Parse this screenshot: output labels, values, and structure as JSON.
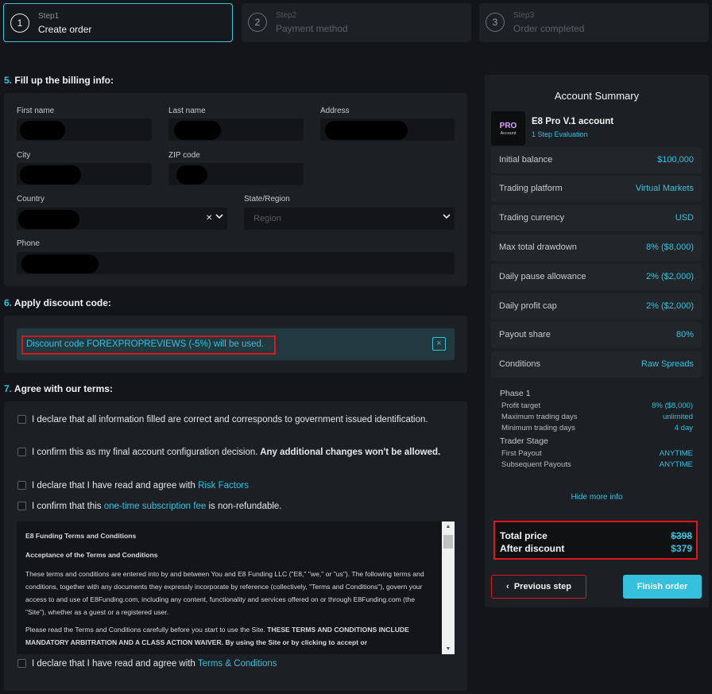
{
  "steps": [
    {
      "num": "1",
      "small": "Step1",
      "label": "Create order"
    },
    {
      "num": "2",
      "small": "Step2",
      "label": "Payment method"
    },
    {
      "num": "3",
      "small": "Step3",
      "label": "Order completed"
    }
  ],
  "billing": {
    "num": "5.",
    "title": "Fill up the billing info:",
    "first_name_label": "First name",
    "last_name_label": "Last name",
    "address_label": "Address",
    "city_label": "City",
    "zip_label": "ZIP code",
    "country_label": "Country",
    "state_label": "State/Region",
    "state_placeholder": "Region",
    "phone_label": "Phone"
  },
  "discount": {
    "num": "6.",
    "title": "Apply discount code:",
    "message": "Discount code FOREXPROPREVIEWS (-5%) will be used.",
    "close": "×"
  },
  "terms": {
    "num": "7.",
    "title": "Agree with our terms:",
    "items": [
      {
        "text": "I declare that all information filled are correct and corresponds to government issued identification."
      },
      {
        "pre": "I confirm this as my final account configuration decision.",
        "bold": " Any additional changes won't be allowed."
      },
      {
        "pre": "I declare that I have read and agree with ",
        "link": "Risk Factors"
      },
      {
        "pre": "I confirm that this ",
        "link": "one-time subscription fee",
        "post": " is non-refundable."
      }
    ],
    "doc": {
      "heading": "E8 Funding Terms and Conditions",
      "subheading": "Acceptance of the Terms and Conditions",
      "p1": "These terms and conditions are entered into by and between You and E8 Funding LLC (\"E8,\" \"we,\" or \"us\"). The following terms and conditions, together with any documents they expressly incorporate by reference (collectively, \"Terms and Conditions\"), govern your access to and use of E8Funding.com, including any content, functionality and services offered on or through E8Funding.com (the \"Site\"), whether as a guest or a registered user.",
      "p2_pre": "Please read the Terms and Conditions carefully before you start to use the Site. ",
      "p2_bold": "THESE TERMS AND CONDITIONS INCLUDE MANDATORY ARBITRATION AND A CLASS ACTION WAIVER. By using the Site or by clicking to accept or"
    },
    "last_pre": "I declare that I have read and agree with ",
    "last_link": "Terms & Conditions"
  },
  "summary": {
    "title": "Account Summary",
    "logo_top": "PRO",
    "logo_bottom": "Account",
    "account_name": "E8 Pro V.1 account",
    "account_sub": "1 Step Evaluation",
    "rows": [
      {
        "k": "Initial balance",
        "v": "$100,000"
      },
      {
        "k": "Trading platform",
        "v": "Virtual Markets"
      },
      {
        "k": "Trading currency",
        "v": "USD"
      },
      {
        "k": "Max total drawdown",
        "v": "8% ($8,000)"
      },
      {
        "k": "Daily pause allowance",
        "v": "2% ($2,000)"
      },
      {
        "k": "Daily profit cap",
        "v": "2% ($2,000)"
      },
      {
        "k": "Payout share",
        "v": "80%"
      },
      {
        "k": "Conditions",
        "v": "Raw Spreads"
      }
    ],
    "phase_title": "Phase 1",
    "phase_rows": [
      {
        "k": "Profit target",
        "v": "8% ($8,000)"
      },
      {
        "k": "Maximum trading days",
        "v": "unlimited"
      },
      {
        "k": "Minimum trading days",
        "v": "4 day"
      }
    ],
    "trader_title": "Trader Stage",
    "trader_rows": [
      {
        "k": "First Payout",
        "v": "ANYTIME"
      },
      {
        "k": "Subsequent Payouts",
        "v": "ANYTIME"
      }
    ],
    "hide_info": "Hide more info",
    "total_label": "Total price",
    "total_value": "$398",
    "after_label": "After discount",
    "after_value": "$379",
    "prev_button": "Previous step",
    "finish_button": "Finish order"
  },
  "colors": {
    "accent": "#35c1dd",
    "highlight": "#e0161a",
    "background": "#131518",
    "panel": "#1c1f23"
  }
}
